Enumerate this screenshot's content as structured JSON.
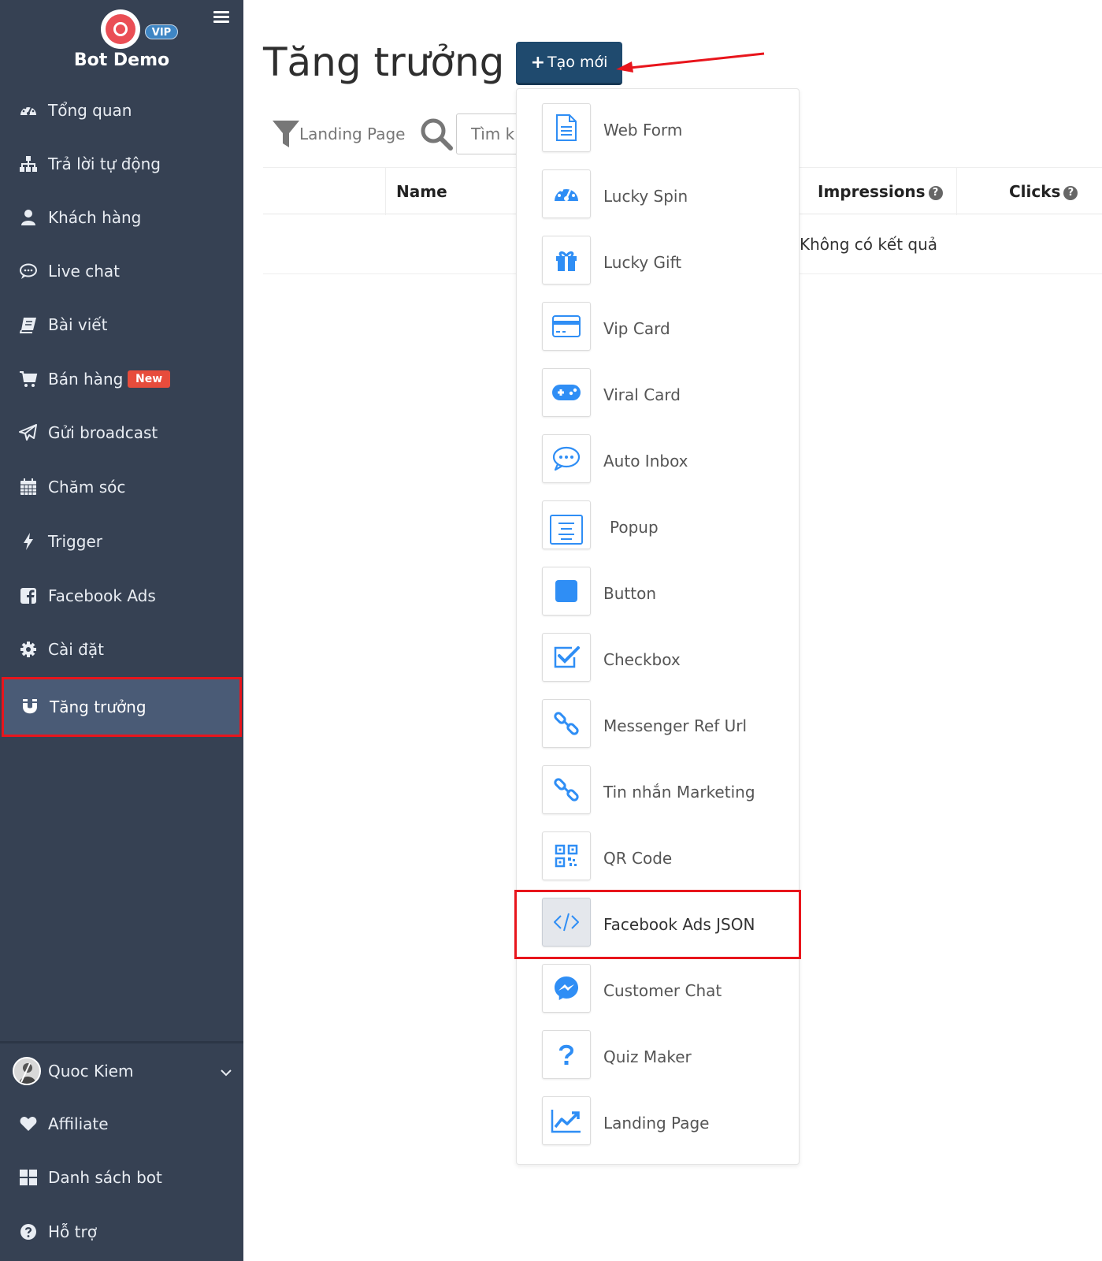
{
  "brand": {
    "name": "Bot Demo",
    "badge": "VIP"
  },
  "sidebar": {
    "items": [
      {
        "label": "Tổng quan",
        "icon": "dashboard-icon"
      },
      {
        "label": "Trả lời tự động",
        "icon": "sitemap-icon"
      },
      {
        "label": "Khách hàng",
        "icon": "user-icon"
      },
      {
        "label": "Live chat",
        "icon": "chat-icon"
      },
      {
        "label": "Bài viết",
        "icon": "book-icon"
      },
      {
        "label": "Bán hàng",
        "icon": "cart-icon",
        "badge": "New"
      },
      {
        "label": "Gửi broadcast",
        "icon": "paper-plane-icon"
      },
      {
        "label": "Chăm sóc",
        "icon": "calendar-icon"
      },
      {
        "label": "Trigger",
        "icon": "bolt-icon"
      },
      {
        "label": "Facebook Ads",
        "icon": "facebook-icon"
      },
      {
        "label": "Cài đặt",
        "icon": "gear-icon"
      },
      {
        "label": "Tăng trưởng",
        "icon": "magnet-icon",
        "active": true
      }
    ],
    "bottom": [
      {
        "label": "Quoc Kiem",
        "icon": "avatar"
      },
      {
        "label": "Affiliate",
        "icon": "heart-icon"
      },
      {
        "label": "Danh sách bot",
        "icon": "grid-icon"
      },
      {
        "label": "Hỗ trợ",
        "icon": "question-circle-icon"
      }
    ]
  },
  "main": {
    "title": "Tăng trưởng",
    "create_button": "Tạo mới",
    "filter_label": "Landing Page",
    "search_placeholder": "Tìm ki",
    "columns": {
      "name": "Name",
      "impressions": "Impressions",
      "clicks": "Clicks"
    },
    "empty_text": "Không có kết quả"
  },
  "dropdown": {
    "items": [
      {
        "label": "Web Form",
        "icon": "file-icon"
      },
      {
        "label": "Lucky Spin",
        "icon": "gauge-icon"
      },
      {
        "label": "Lucky Gift",
        "icon": "gift-icon"
      },
      {
        "label": "Vip Card",
        "icon": "credit-card-icon"
      },
      {
        "label": "Viral Card",
        "icon": "gamepad-icon"
      },
      {
        "label": "Auto Inbox",
        "icon": "comment-dots-icon"
      },
      {
        "label": "Popup",
        "icon": "popup-icon"
      },
      {
        "label": "Button",
        "icon": "square-icon"
      },
      {
        "label": "Checkbox",
        "icon": "checkbox-icon"
      },
      {
        "label": "Messenger Ref Url",
        "icon": "link-icon"
      },
      {
        "label": "Tin nhắn Marketing",
        "icon": "link-icon"
      },
      {
        "label": "QR Code",
        "icon": "qrcode-icon"
      },
      {
        "label": "Facebook Ads JSON",
        "icon": "code-icon",
        "highlighted": true
      },
      {
        "label": "Customer Chat",
        "icon": "messenger-icon"
      },
      {
        "label": "Quiz Maker",
        "icon": "question-icon"
      },
      {
        "label": "Landing Page",
        "icon": "line-chart-icon"
      }
    ]
  },
  "colors": {
    "sidebar": "#364153",
    "accent": "#2f8ef5",
    "create_button": "#1f4a6e",
    "highlight_border": "#e8151c",
    "badge_new": "#e74c3c"
  }
}
